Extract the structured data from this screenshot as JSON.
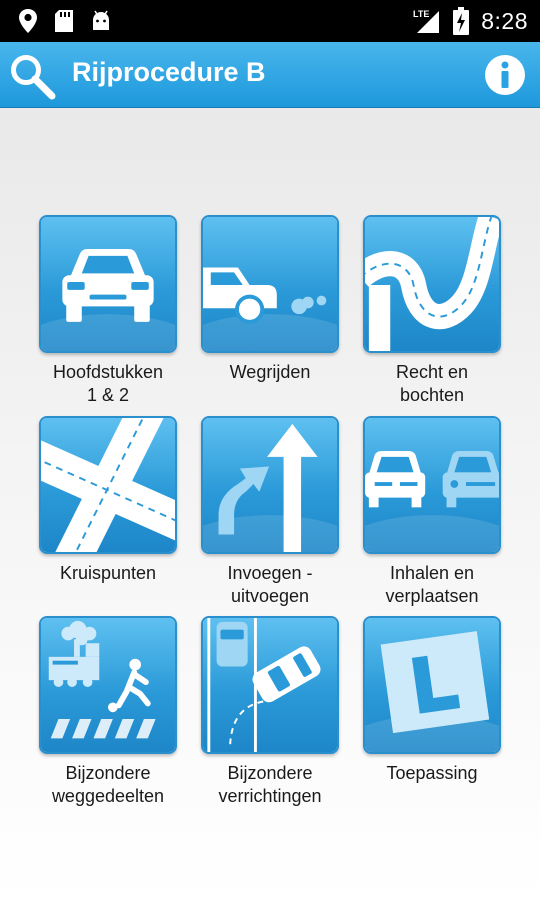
{
  "status_bar": {
    "time": "8:28",
    "network": "LTE",
    "icons": [
      "location-icon",
      "sd-card-icon",
      "android-icon",
      "signal-icon",
      "battery-charging-icon"
    ]
  },
  "app_bar": {
    "title": "Rijprocedure B",
    "search_icon": "search-icon",
    "info_icon": "info-icon",
    "color": "#2aa3e3"
  },
  "tiles": [
    {
      "label": "Hoofdstukken\n1 & 2",
      "icon": "car-front-icon"
    },
    {
      "label": "Wegrijden",
      "icon": "car-driving-away-icon"
    },
    {
      "label": "Recht en\nbochten",
      "icon": "winding-road-icon"
    },
    {
      "label": "Kruispunten",
      "icon": "crossroads-icon"
    },
    {
      "label": "Invoegen -\nuitvoegen",
      "icon": "merge-arrows-icon"
    },
    {
      "label": "Inhalen en\nverplaatsen",
      "icon": "overtaking-cars-icon"
    },
    {
      "label": "Bijzondere\nweggedeelten",
      "icon": "train-crossing-pedestrian-icon"
    },
    {
      "label": "Bijzondere\nverrichtingen",
      "icon": "parking-maneuver-icon"
    },
    {
      "label": "Toepassing",
      "icon": "learner-l-plate-icon"
    }
  ],
  "colors": {
    "tile_blue": "#2b9ad8",
    "tile_blue_light": "#4fb6ec"
  }
}
